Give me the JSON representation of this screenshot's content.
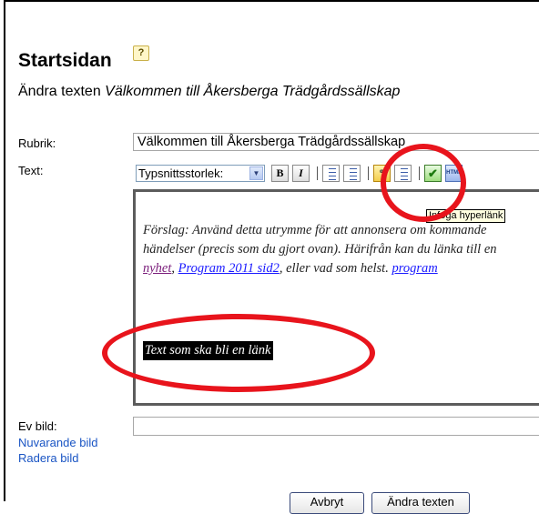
{
  "page": {
    "title": "Startsidan",
    "help_glyph": "?",
    "subtitle_prefix": "Ändra texten ",
    "subtitle_name": "Välkommen till Åkersberga Trädgårdssällskap"
  },
  "form": {
    "rubrik_label": "Rubrik:",
    "rubrik_value": "Välkommen till Åkersberga Trädgårdssällskap",
    "text_label": "Text:",
    "evbild_label": "Ev bild:",
    "nuvarande_bild_link": "Nuvarande bild",
    "radera_bild_link": "Radera bild"
  },
  "toolbar": {
    "font_size_label": "Typsnittsstorlek:",
    "bold": "B",
    "italic": "I",
    "tooltip": "Infoga hyperlänk"
  },
  "editor": {
    "line1": "Förslag: Använd detta utrymme för att annonsera om kommande",
    "line2": "händelser (precis som du gjort ovan). Härifrån kan du länka till en",
    "link1": "nyhet",
    "sep1": ", ",
    "link2": "Program 2011 sid2",
    "mid": ", eller vad som helst. ",
    "link3": "program",
    "selected_text": "Text som ska bli en länk"
  },
  "buttons": {
    "cancel": "Avbryt",
    "save": "Ändra texten"
  },
  "colors": {
    "annotation_ring": "#e8141c",
    "link": "#1a55c4"
  }
}
